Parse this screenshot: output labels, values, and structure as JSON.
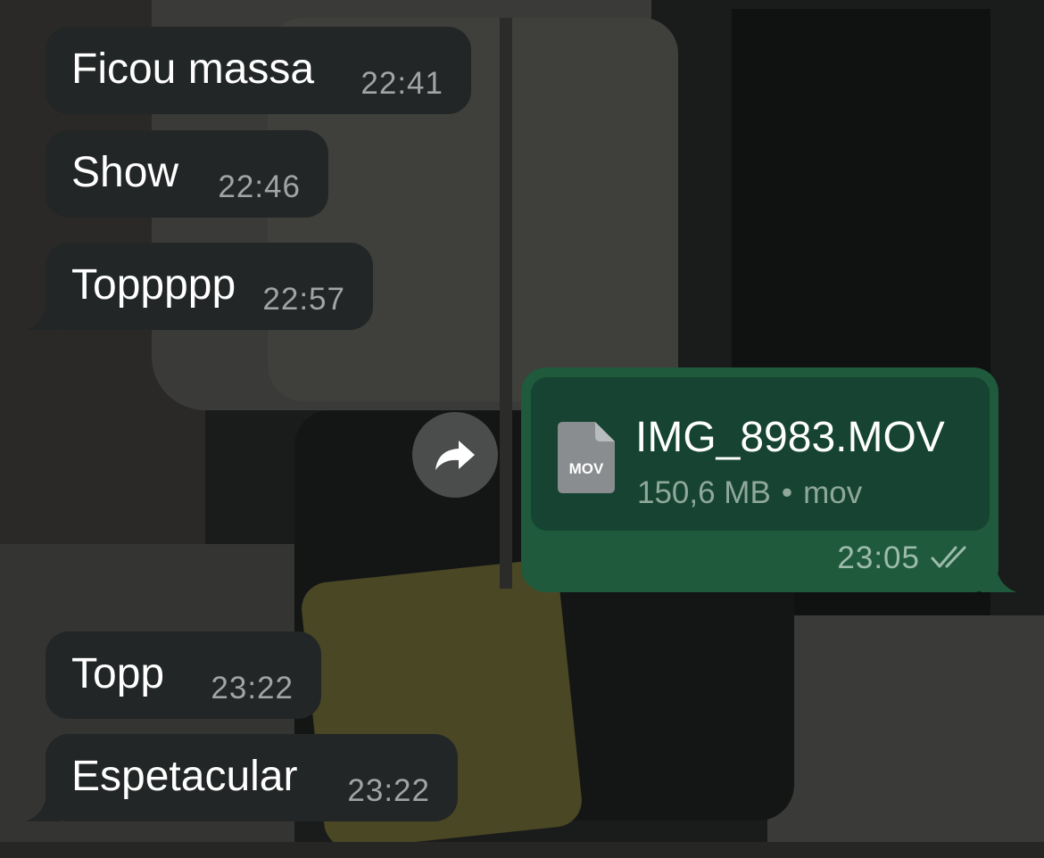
{
  "messages_in": [
    {
      "text": "Ficou massa",
      "time": "22:41"
    },
    {
      "text": "Show",
      "time": "22:46"
    },
    {
      "text": "Toppppp",
      "time": "22:57"
    },
    {
      "text": "Topp",
      "time": "23:22"
    },
    {
      "text": "Espetacular",
      "time": "23:22"
    }
  ],
  "message_out": {
    "file_name": "IMG_8983.MOV",
    "file_type_badge": "MOV",
    "file_size": "150,6 MB",
    "file_ext": "mov",
    "separator": "•",
    "time": "23:05",
    "status": "read"
  },
  "icons": {
    "forward": "forward-arrow-icon",
    "file": "document-icon",
    "ticks": "double-check-icon"
  },
  "colors": {
    "incoming_bubble": "#232626",
    "outgoing_bubble": "#1f5a3c",
    "file_card": "#164332",
    "timestamp": "#a0a4a4"
  }
}
